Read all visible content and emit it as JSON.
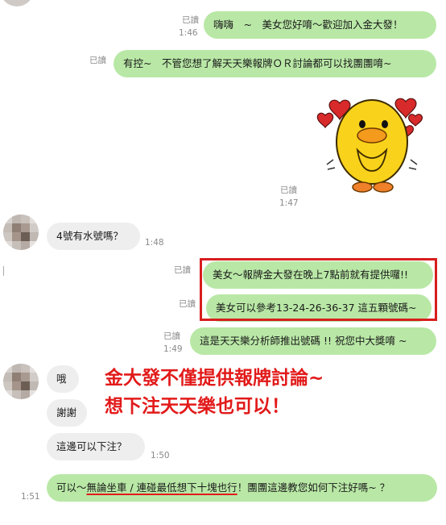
{
  "messages": {
    "m1": {
      "text": "嗨嗨　~　美女您好唷～歡迎加入金大發！",
      "read": "已讀",
      "time": "1:46"
    },
    "m2": {
      "text": "有控~　不管您想了解天天樂報牌ＯＲ討論都可以找團團唷~",
      "read": "已讀"
    },
    "sticker": {
      "read": "已讀",
      "time": "1:47"
    },
    "m3": {
      "text": "4號有水號嗎？",
      "time": "1:48"
    },
    "m4": {
      "text": "美女～報牌金大發在晚上7點前就有提供囉!!",
      "read": "已讀"
    },
    "m5": {
      "text": "美女可以參考13-24-26-36-37 這五顆號碼~",
      "read": "已讀"
    },
    "m6": {
      "text": "這是天天樂分析師推出號碼 !! 祝您中大獎唷 ~",
      "read": "已讀",
      "time": "1:49"
    },
    "m7": {
      "text": "哦"
    },
    "m8": {
      "text": "謝謝"
    },
    "m9": {
      "text": "這邊可以下注？",
      "time": "1:50"
    },
    "m10": {
      "prefix": "可以～",
      "underlined": "無論坐車 / 連碰最低想下十塊也行",
      "mark": "！",
      "suffix": "團團這邊教您如何下注好嗎~ ？",
      "time": "1:51"
    }
  },
  "annotation": {
    "line1": "金大發不僅提供報牌討論~",
    "line2": "想下注天天樂也可以！"
  },
  "colors": {
    "outgoing_bubble": "#b9e8a6",
    "incoming_bubble": "#eeeeee",
    "annotation_red": "#e21a1a"
  }
}
